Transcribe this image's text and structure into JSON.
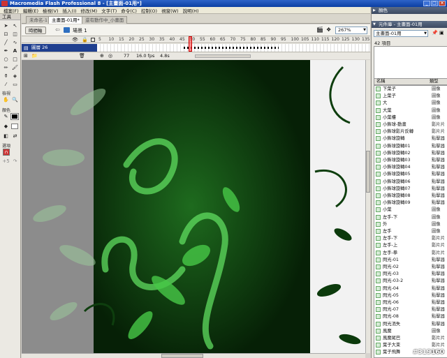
{
  "window": {
    "title": "Macromedia Flash Professional 8 - [主畫面-01用*]",
    "controls": [
      "_",
      "□",
      "×"
    ]
  },
  "menu": [
    "檔案(F)",
    "編輯(E)",
    "檢視(V)",
    "插入(I)",
    "修改(M)",
    "文字(T)",
    "命令(C)",
    "控制(O)",
    "視窗(W)",
    "說明(H)"
  ],
  "tools": {
    "title": "工具",
    "view_label": "檢視",
    "colors_label": "顏色",
    "options_label": "選項"
  },
  "doc_tabs": [
    "未命名-1",
    "主畫面-01用*",
    "還有動作中_小畫面"
  ],
  "edit_bar": {
    "timeline_button": "時間軸",
    "scene": "場景 1",
    "zoom": "267%"
  },
  "timeline": {
    "layer_name": "圖層 26",
    "frame_numbers": [
      "5",
      "10",
      "15",
      "20",
      "25",
      "30",
      "35",
      "40",
      "45",
      "50",
      "55",
      "60",
      "65",
      "70",
      "75",
      "80",
      "85",
      "90",
      "95",
      "100",
      "105",
      "110",
      "115",
      "120",
      "125",
      "130",
      "135"
    ],
    "current_frame": "77",
    "fps": "16.0 fps",
    "time": "4.8s"
  },
  "right_panel": {
    "color_panel_title": "顏色",
    "library_panel_title": "元件庫 - 主畫面-01用",
    "library_select": "主畫面-01用",
    "item_count": "42 項目",
    "col_name": "名稱",
    "col_type": "類型"
  },
  "library_items": [
    {
      "name": "下葉子",
      "type": "圖像"
    },
    {
      "name": "上葉子",
      "type": "圖像"
    },
    {
      "name": "大",
      "type": "圖像"
    },
    {
      "name": "大葉",
      "type": "圖像"
    },
    {
      "name": "小葉樓",
      "type": "圖像"
    },
    {
      "name": "小飾球-動畫",
      "type": "影片片"
    },
    {
      "name": "小飾球影片反轉",
      "type": "影片片"
    },
    {
      "name": "小飾球旋轉",
      "type": "點擊器"
    },
    {
      "name": "小飾球旋轉01",
      "type": "點擊器"
    },
    {
      "name": "小飾球旋轉02",
      "type": "點擊器"
    },
    {
      "name": "小飾球旋轉03",
      "type": "點擊器"
    },
    {
      "name": "小飾球旋轉04",
      "type": "點擊器"
    },
    {
      "name": "小飾球旋轉05",
      "type": "點擊器"
    },
    {
      "name": "小飾球旋轉06",
      "type": "點擊器"
    },
    {
      "name": "小飾球旋轉07",
      "type": "點擊器"
    },
    {
      "name": "小飾球旋轉08",
      "type": "點擊器"
    },
    {
      "name": "小飾球旋轉09",
      "type": "點擊器"
    },
    {
      "name": "小葉",
      "type": "圖像"
    },
    {
      "name": "左手-下",
      "type": "圖像"
    },
    {
      "name": "外",
      "type": "圖像"
    },
    {
      "name": "左手",
      "type": "圖像"
    },
    {
      "name": "左手-下",
      "type": "影片片"
    },
    {
      "name": "左手-上",
      "type": "影片片"
    },
    {
      "name": "左手-拳",
      "type": "影片片"
    },
    {
      "name": "閃光-01",
      "type": "點擊器"
    },
    {
      "name": "閃光-02",
      "type": "點擊器"
    },
    {
      "name": "閃光-03",
      "type": "點擊器"
    },
    {
      "name": "閃光-03-2",
      "type": "點擊器"
    },
    {
      "name": "閃光-04",
      "type": "點擊器"
    },
    {
      "name": "閃光-05",
      "type": "點擊器"
    },
    {
      "name": "閃光-06",
      "type": "點擊器"
    },
    {
      "name": "閃光-07",
      "type": "點擊器"
    },
    {
      "name": "閃光-08",
      "type": "點擊器"
    },
    {
      "name": "閃光消失",
      "type": "點擊器"
    },
    {
      "name": "風魔",
      "type": "圖像"
    },
    {
      "name": "風魔尾巴",
      "type": "影片片"
    },
    {
      "name": "葉子大束",
      "type": "影片片"
    },
    {
      "name": "葉子飛舞",
      "type": "影片片"
    }
  ],
  "watermark": "#319160",
  "colors": {
    "accent": "#0b3fa3",
    "stage_dark": "#0b2a0b",
    "stage_green": "#3fbf3f"
  }
}
